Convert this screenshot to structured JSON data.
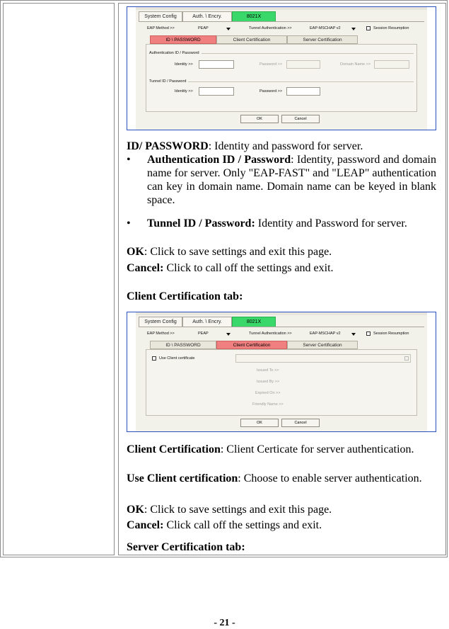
{
  "dialog": {
    "main_tabs": [
      "System Config",
      "Auth. \\ Encry.",
      "8021X"
    ],
    "eap_method_label": "EAP Method >>",
    "eap_method_value": "PEAP",
    "tunnel_auth_label": "Tunnel Authentication >>",
    "tunnel_auth_value": "EAP-MSCHAP v2",
    "session_resumption": "Session Resumption",
    "sub_tabs": [
      "ID \\ PASSWORD",
      "Client Certification",
      "Server Certification"
    ],
    "auth_group_title": "Authentication ID / Password",
    "tunnel_group_title": "Tunnel ID / Password",
    "identity_label": "Identity >>",
    "password_label": "Password >>",
    "domain_label": "Domain Name >>",
    "use_client_cert": "Use Client certificate",
    "issued_to": "Issued To >>",
    "issued_by": "Issued By >>",
    "expired_on": "Expired On >>",
    "friendly_name": "Friendly Name >>",
    "ok": "OK",
    "cancel": "Cancel"
  },
  "text": {
    "idpw_term": "ID/ PASSWORD",
    "idpw_desc": ": Identity and password for server.",
    "auth_term": "Authentication ID / Password",
    "auth_desc": ": Identity, password and domain name for server. Only \"EAP-FAST\" and \"LEAP\" authentication can key in domain name. Domain name can be keyed in blank space.",
    "tunnel_term": "Tunnel ID / Password:",
    "tunnel_desc": " Identity and Password for server.",
    "ok_term": "OK",
    "ok_desc": ": Click to save settings and exit this page.",
    "cancel_term": "Cancel:",
    "cancel_desc": " Click to call off the settings and exit.",
    "client_tab_heading": "Client Certification tab:",
    "cc_term": "Client Certification",
    "cc_desc": ": Client Certicate for server authentication.",
    "ucc_term": "Use Client certification",
    "ucc_desc": ": Choose to enable server authentication.",
    "ok2_term": "OK",
    "ok2_desc": ": Click to save settings and exit this page.",
    "cancel2_term": "Cancel:",
    "cancel2_desc": " Click call off the settings and exit.",
    "server_tab_heading": "Server Certification tab:",
    "bullet": "•"
  },
  "page_number": "- 21 -",
  "colors": {
    "active_main_tab": "#3ad86a",
    "active_sub_tab": "#f08080",
    "screenshot_border": "#2a4fbf"
  }
}
